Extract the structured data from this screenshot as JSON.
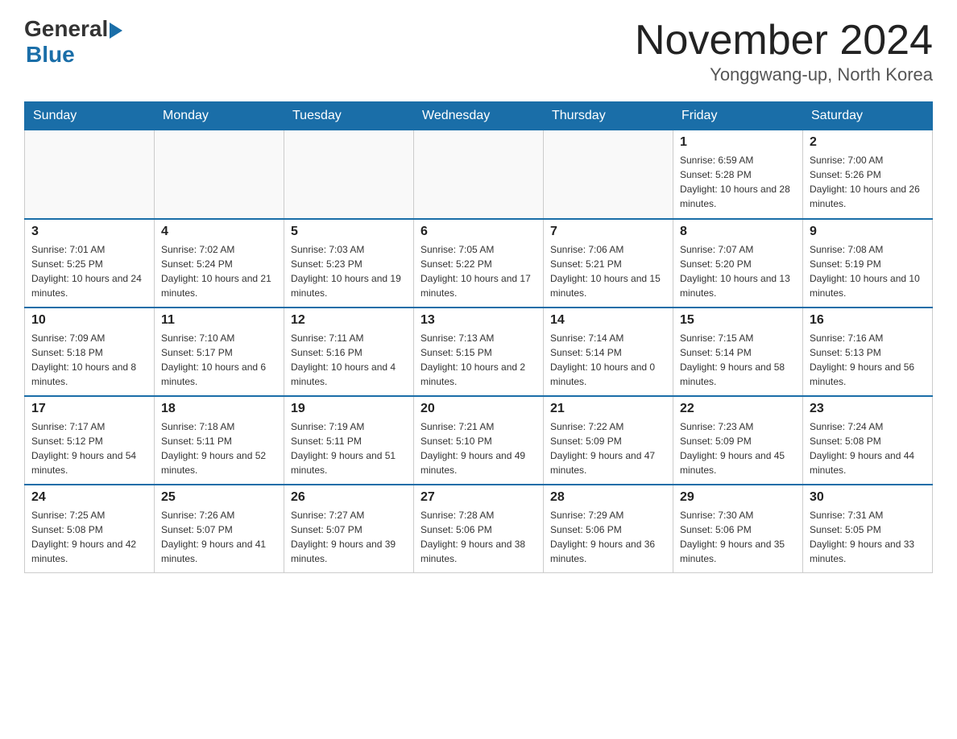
{
  "header": {
    "logo_general": "General",
    "logo_blue": "Blue",
    "month_title": "November 2024",
    "location": "Yonggwang-up, North Korea"
  },
  "weekdays": [
    "Sunday",
    "Monday",
    "Tuesday",
    "Wednesday",
    "Thursday",
    "Friday",
    "Saturday"
  ],
  "weeks": [
    [
      {
        "day": "",
        "info": ""
      },
      {
        "day": "",
        "info": ""
      },
      {
        "day": "",
        "info": ""
      },
      {
        "day": "",
        "info": ""
      },
      {
        "day": "",
        "info": ""
      },
      {
        "day": "1",
        "info": "Sunrise: 6:59 AM\nSunset: 5:28 PM\nDaylight: 10 hours and 28 minutes."
      },
      {
        "day": "2",
        "info": "Sunrise: 7:00 AM\nSunset: 5:26 PM\nDaylight: 10 hours and 26 minutes."
      }
    ],
    [
      {
        "day": "3",
        "info": "Sunrise: 7:01 AM\nSunset: 5:25 PM\nDaylight: 10 hours and 24 minutes."
      },
      {
        "day": "4",
        "info": "Sunrise: 7:02 AM\nSunset: 5:24 PM\nDaylight: 10 hours and 21 minutes."
      },
      {
        "day": "5",
        "info": "Sunrise: 7:03 AM\nSunset: 5:23 PM\nDaylight: 10 hours and 19 minutes."
      },
      {
        "day": "6",
        "info": "Sunrise: 7:05 AM\nSunset: 5:22 PM\nDaylight: 10 hours and 17 minutes."
      },
      {
        "day": "7",
        "info": "Sunrise: 7:06 AM\nSunset: 5:21 PM\nDaylight: 10 hours and 15 minutes."
      },
      {
        "day": "8",
        "info": "Sunrise: 7:07 AM\nSunset: 5:20 PM\nDaylight: 10 hours and 13 minutes."
      },
      {
        "day": "9",
        "info": "Sunrise: 7:08 AM\nSunset: 5:19 PM\nDaylight: 10 hours and 10 minutes."
      }
    ],
    [
      {
        "day": "10",
        "info": "Sunrise: 7:09 AM\nSunset: 5:18 PM\nDaylight: 10 hours and 8 minutes."
      },
      {
        "day": "11",
        "info": "Sunrise: 7:10 AM\nSunset: 5:17 PM\nDaylight: 10 hours and 6 minutes."
      },
      {
        "day": "12",
        "info": "Sunrise: 7:11 AM\nSunset: 5:16 PM\nDaylight: 10 hours and 4 minutes."
      },
      {
        "day": "13",
        "info": "Sunrise: 7:13 AM\nSunset: 5:15 PM\nDaylight: 10 hours and 2 minutes."
      },
      {
        "day": "14",
        "info": "Sunrise: 7:14 AM\nSunset: 5:14 PM\nDaylight: 10 hours and 0 minutes."
      },
      {
        "day": "15",
        "info": "Sunrise: 7:15 AM\nSunset: 5:14 PM\nDaylight: 9 hours and 58 minutes."
      },
      {
        "day": "16",
        "info": "Sunrise: 7:16 AM\nSunset: 5:13 PM\nDaylight: 9 hours and 56 minutes."
      }
    ],
    [
      {
        "day": "17",
        "info": "Sunrise: 7:17 AM\nSunset: 5:12 PM\nDaylight: 9 hours and 54 minutes."
      },
      {
        "day": "18",
        "info": "Sunrise: 7:18 AM\nSunset: 5:11 PM\nDaylight: 9 hours and 52 minutes."
      },
      {
        "day": "19",
        "info": "Sunrise: 7:19 AM\nSunset: 5:11 PM\nDaylight: 9 hours and 51 minutes."
      },
      {
        "day": "20",
        "info": "Sunrise: 7:21 AM\nSunset: 5:10 PM\nDaylight: 9 hours and 49 minutes."
      },
      {
        "day": "21",
        "info": "Sunrise: 7:22 AM\nSunset: 5:09 PM\nDaylight: 9 hours and 47 minutes."
      },
      {
        "day": "22",
        "info": "Sunrise: 7:23 AM\nSunset: 5:09 PM\nDaylight: 9 hours and 45 minutes."
      },
      {
        "day": "23",
        "info": "Sunrise: 7:24 AM\nSunset: 5:08 PM\nDaylight: 9 hours and 44 minutes."
      }
    ],
    [
      {
        "day": "24",
        "info": "Sunrise: 7:25 AM\nSunset: 5:08 PM\nDaylight: 9 hours and 42 minutes."
      },
      {
        "day": "25",
        "info": "Sunrise: 7:26 AM\nSunset: 5:07 PM\nDaylight: 9 hours and 41 minutes."
      },
      {
        "day": "26",
        "info": "Sunrise: 7:27 AM\nSunset: 5:07 PM\nDaylight: 9 hours and 39 minutes."
      },
      {
        "day": "27",
        "info": "Sunrise: 7:28 AM\nSunset: 5:06 PM\nDaylight: 9 hours and 38 minutes."
      },
      {
        "day": "28",
        "info": "Sunrise: 7:29 AM\nSunset: 5:06 PM\nDaylight: 9 hours and 36 minutes."
      },
      {
        "day": "29",
        "info": "Sunrise: 7:30 AM\nSunset: 5:06 PM\nDaylight: 9 hours and 35 minutes."
      },
      {
        "day": "30",
        "info": "Sunrise: 7:31 AM\nSunset: 5:05 PM\nDaylight: 9 hours and 33 minutes."
      }
    ]
  ]
}
